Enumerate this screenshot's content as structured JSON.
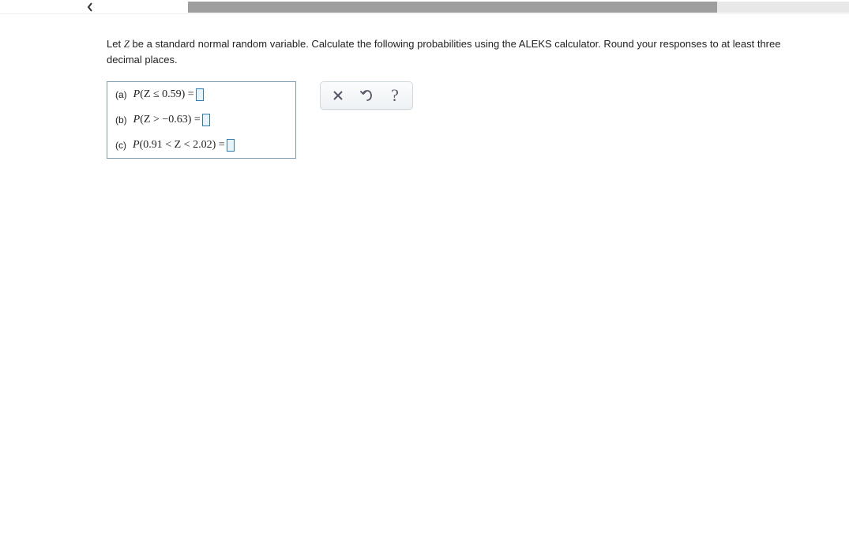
{
  "prompt": "Let Z be a standard normal random variable. Calculate the following probabilities using the ALEKS calculator. Round your responses to at least three decimal places.",
  "parts": {
    "a": {
      "label": "(a)",
      "expr_prefix": "P",
      "expr_body": "(Z ≤ 0.59)",
      "eq": " = "
    },
    "b": {
      "label": "(b)",
      "expr_prefix": "P",
      "expr_body": "(Z > −0.63)",
      "eq": " = "
    },
    "c": {
      "label": "(c)",
      "expr_prefix": "P",
      "expr_body": "(0.91 < Z < 2.02)",
      "eq": " = "
    }
  },
  "toolbar": {
    "clear": "clear",
    "undo": "undo",
    "help": "?"
  }
}
